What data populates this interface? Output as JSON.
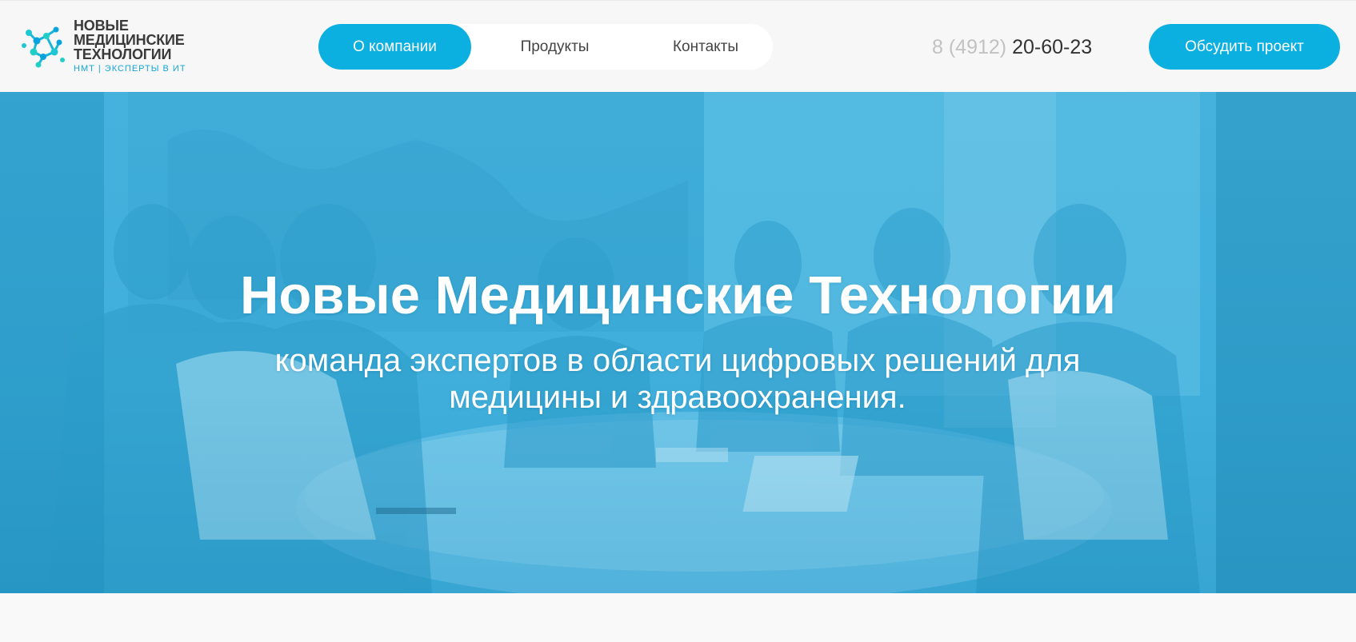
{
  "header": {
    "logo": {
      "line1": "НОВЫЕ",
      "line2": "МЕДИЦИНСКИЕ",
      "line3": "ТЕХНОЛОГИИ",
      "tagline": "НМТ | ЭКСПЕРТЫ В ИТ",
      "icon": "molecule-logo-icon"
    },
    "nav": [
      {
        "label": "О компании",
        "active": true
      },
      {
        "label": "Продукты",
        "active": false
      },
      {
        "label": "Контакты",
        "active": false
      }
    ],
    "phone": {
      "code": "8 (4912)",
      "number": "20-60-23"
    },
    "cta_label": "Обсудить проект"
  },
  "hero": {
    "title": "Новые Медицинские Технологии",
    "subtitle": "команда экспертов в области цифровых решений для медицины и здравоохранения.",
    "background": "meeting-photo-blue-tint"
  },
  "colors": {
    "accent": "#0cb0e0",
    "text_dark": "#333333",
    "phone_code": "#c2c2c2",
    "page_bg": "#f7f7f7"
  }
}
